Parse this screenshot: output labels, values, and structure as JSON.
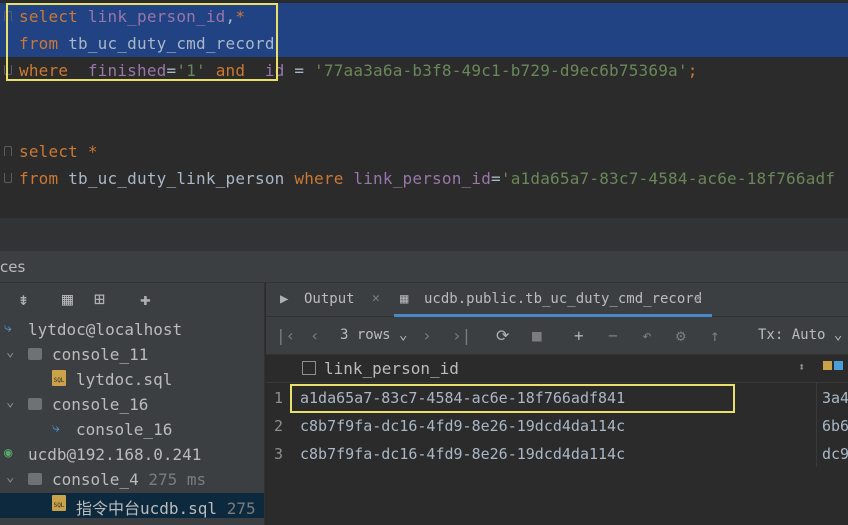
{
  "editor": {
    "line1": {
      "kw": "select",
      "ids": "link_person_id",
      "sep": ",",
      "star": "*"
    },
    "line2": {
      "kw": "from",
      "table": "tb_uc_duty_cmd_record"
    },
    "line3": {
      "kw": "where",
      "col1": "finished",
      "eq1": "=",
      "val1": "'1'",
      "and": "and",
      "col2": "id",
      "eq2": " = ",
      "val2": "'77aa3a6a-b3f8-49c1-b729-d9ec6b75369a'",
      "end": ";"
    },
    "line4": {
      "kw": "select",
      "star": "*"
    },
    "line5": {
      "kw": "from",
      "table": "tb_uc_duty_link_person",
      "where": "where",
      "col": "link_person_id",
      "eq": "=",
      "val": "'a1da65a7-83c7-4584-ac6e-18f766adf"
    }
  },
  "services": {
    "title": "ces"
  },
  "tree": [
    {
      "label": "lytdoc@localhost",
      "meta": ""
    },
    {
      "label": "console_11",
      "meta": ""
    },
    {
      "label": "lytdoc.sql",
      "meta": ""
    },
    {
      "label": "console_16",
      "meta": ""
    },
    {
      "label": "console_16",
      "meta": ""
    },
    {
      "label": "ucdb@192.168.0.241",
      "meta": ""
    },
    {
      "label": "console_4",
      "meta": "275 ms"
    },
    {
      "label": "指令中台ucdb.sql",
      "meta": "275"
    }
  ],
  "tabs": {
    "output": "Output",
    "table": "ucdb.public.tb_uc_duty_cmd_record"
  },
  "grid_toolbar": {
    "rows": "3 rows",
    "tx": "Tx: Auto"
  },
  "grid": {
    "column": "link_person_id",
    "rows": [
      {
        "num": "1",
        "value": "a1da65a7-83c7-4584-ac6e-18f766adf841",
        "next": "3a4"
      },
      {
        "num": "2",
        "value": "c8b7f9fa-dc16-4fd9-8e26-19dcd4da114c",
        "next": "6b6"
      },
      {
        "num": "3",
        "value": "c8b7f9fa-dc16-4fd9-8e26-19dcd4da114c",
        "next": "dc9"
      }
    ]
  },
  "colors": {
    "accent_highlight": "#e8e06a",
    "selection": "#214283",
    "keyword": "#cc7832"
  }
}
